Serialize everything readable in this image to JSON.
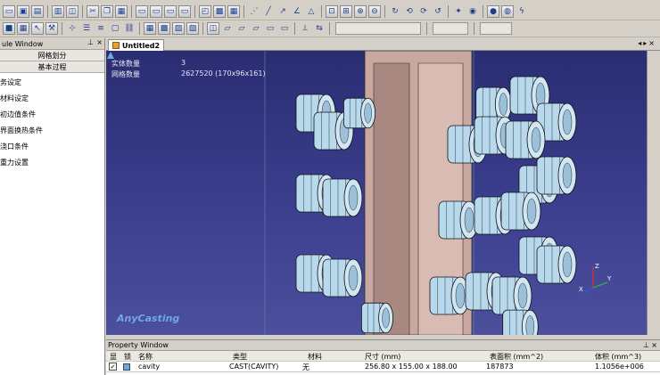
{
  "window": {
    "left_panel_title": "ule Window",
    "doc_tab_label": "Untitled2",
    "property_window_title": "Property Window"
  },
  "left_panel": {
    "buttons": [
      "网格划分",
      "基本过程"
    ],
    "items": [
      "务设定",
      "材料设定",
      "初边值条件",
      "界面换热条件",
      "浇口条件",
      "重力设置"
    ]
  },
  "viewport": {
    "info": [
      {
        "label": "实体数量",
        "value": "3"
      },
      {
        "label": "网格数量",
        "value": "2627520 (170x96x161)"
      }
    ],
    "logo_text": "AnyCasting",
    "axes": {
      "x": "X",
      "y": "Y",
      "z": "Z"
    },
    "colors": {
      "background_top": "#2a2d72",
      "background_bottom": "#4b4f9c",
      "part": "#b8d8ec",
      "cavity": "#c9a8a0"
    }
  },
  "toolbar_icons": [
    "new-icon",
    "open-icon",
    "save-icon",
    "print-icon",
    "preview-icon",
    "cut-icon",
    "copy-icon",
    "paste-icon",
    "undo-icon",
    "select-icon",
    "pan-icon",
    "rotate-icon",
    "zoom-icon",
    "fit-icon",
    "measure-icon",
    "line-icon",
    "shape-icon"
  ],
  "property_table": {
    "headers": {
      "show": "显",
      "lock": "锁",
      "name": "名称",
      "type": "类型",
      "material": "材料",
      "size": "尺寸 (mm)",
      "area": "表面积 (mm^2)",
      "volume": "体积 (mm^3)"
    },
    "rows": [
      {
        "checked": true,
        "name": "cavity",
        "type": "CAST(CAVITY)",
        "material": "无",
        "size": "256.80 x 155.00 x 188.00",
        "area": "187873",
        "volume": "1.1056e+006"
      }
    ]
  }
}
